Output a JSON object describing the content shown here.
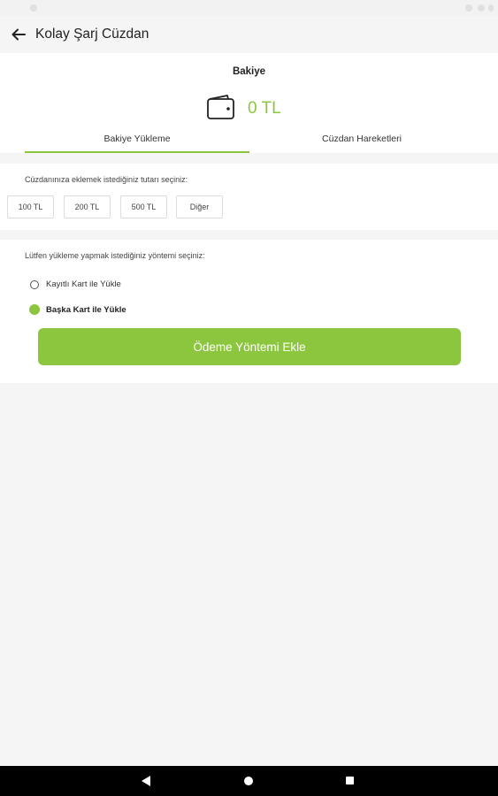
{
  "appbar": {
    "title": "Kolay Şarj Cüzdan",
    "back_icon": "arrow-left-icon"
  },
  "balance": {
    "label": "Bakiye",
    "amount": "0 TL",
    "wallet_icon": "wallet-icon",
    "accent_color": "#8cc63f"
  },
  "tabs": [
    {
      "label": "Bakiye Yükleme",
      "active": true
    },
    {
      "label": "Cüzdan Hareketleri",
      "active": false
    }
  ],
  "amount_section": {
    "prompt": "Cüzdanınıza eklemek istediğiniz tutarı seçiniz:",
    "options": [
      "100 TL",
      "200 TL",
      "500 TL",
      "Diğer"
    ]
  },
  "method_section": {
    "prompt": "Lütfen yükleme yapmak istediğiniz yöntemi seçiniz:",
    "options": [
      {
        "label": "Kayıtlı Kart ile Yükle",
        "selected": false
      },
      {
        "label": "Başka Kart ile Yükle",
        "selected": true
      }
    ],
    "add_button": "Ödeme Yöntemi Ekle"
  },
  "system_nav": {
    "back": "back-icon",
    "home": "home-icon",
    "recents": "recents-icon"
  }
}
